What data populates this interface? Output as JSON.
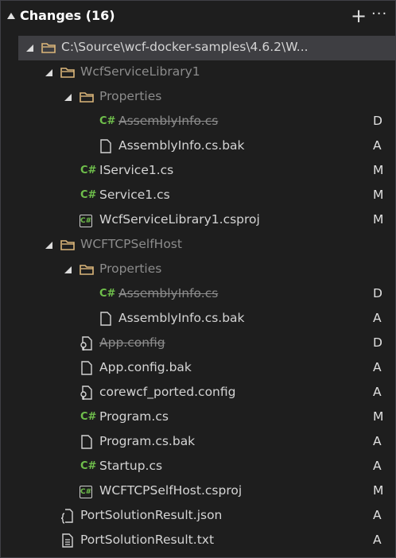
{
  "panel": {
    "title": "Changes (16)",
    "plus": "+",
    "more": "···"
  },
  "rows": [
    {
      "label": "C:\\Source\\wcf-docker-samples\\4.6.2\\W...",
      "status": ""
    },
    {
      "label": "WcfServiceLibrary1",
      "status": ""
    },
    {
      "label": "Properties",
      "status": ""
    },
    {
      "label": "AssemblyInfo.cs",
      "status": "D"
    },
    {
      "label": "AssemblyInfo.cs.bak",
      "status": "A"
    },
    {
      "label": "IService1.cs",
      "status": "M"
    },
    {
      "label": "Service1.cs",
      "status": "M"
    },
    {
      "label": "WcfServiceLibrary1.csproj",
      "status": "M"
    },
    {
      "label": "WCFTCPSelfHost",
      "status": ""
    },
    {
      "label": "Properties",
      "status": ""
    },
    {
      "label": "AssemblyInfo.cs",
      "status": "D"
    },
    {
      "label": "AssemblyInfo.cs.bak",
      "status": "A"
    },
    {
      "label": "App.config",
      "status": "D"
    },
    {
      "label": "App.config.bak",
      "status": "A"
    },
    {
      "label": "corewcf_ported.config",
      "status": "A"
    },
    {
      "label": "Program.cs",
      "status": "M"
    },
    {
      "label": "Program.cs.bak",
      "status": "A"
    },
    {
      "label": "Startup.cs",
      "status": "A"
    },
    {
      "label": "WCFTCPSelfHost.csproj",
      "status": "M"
    },
    {
      "label": "PortSolutionResult.json",
      "status": "A"
    },
    {
      "label": "PortSolutionResult.txt",
      "status": "A"
    }
  ],
  "icons": {
    "folder": "folder-icon",
    "csharp": "csharp-file-icon",
    "file": "file-icon",
    "csproj": "csproj-icon",
    "config": "config-file-icon",
    "json": "json-file-icon",
    "text": "text-file-icon"
  },
  "colors": {
    "csharp": "#6fbf4b",
    "folder": "#dcb67a",
    "background": "#1e1e1e",
    "selected": "#3e3e42"
  }
}
